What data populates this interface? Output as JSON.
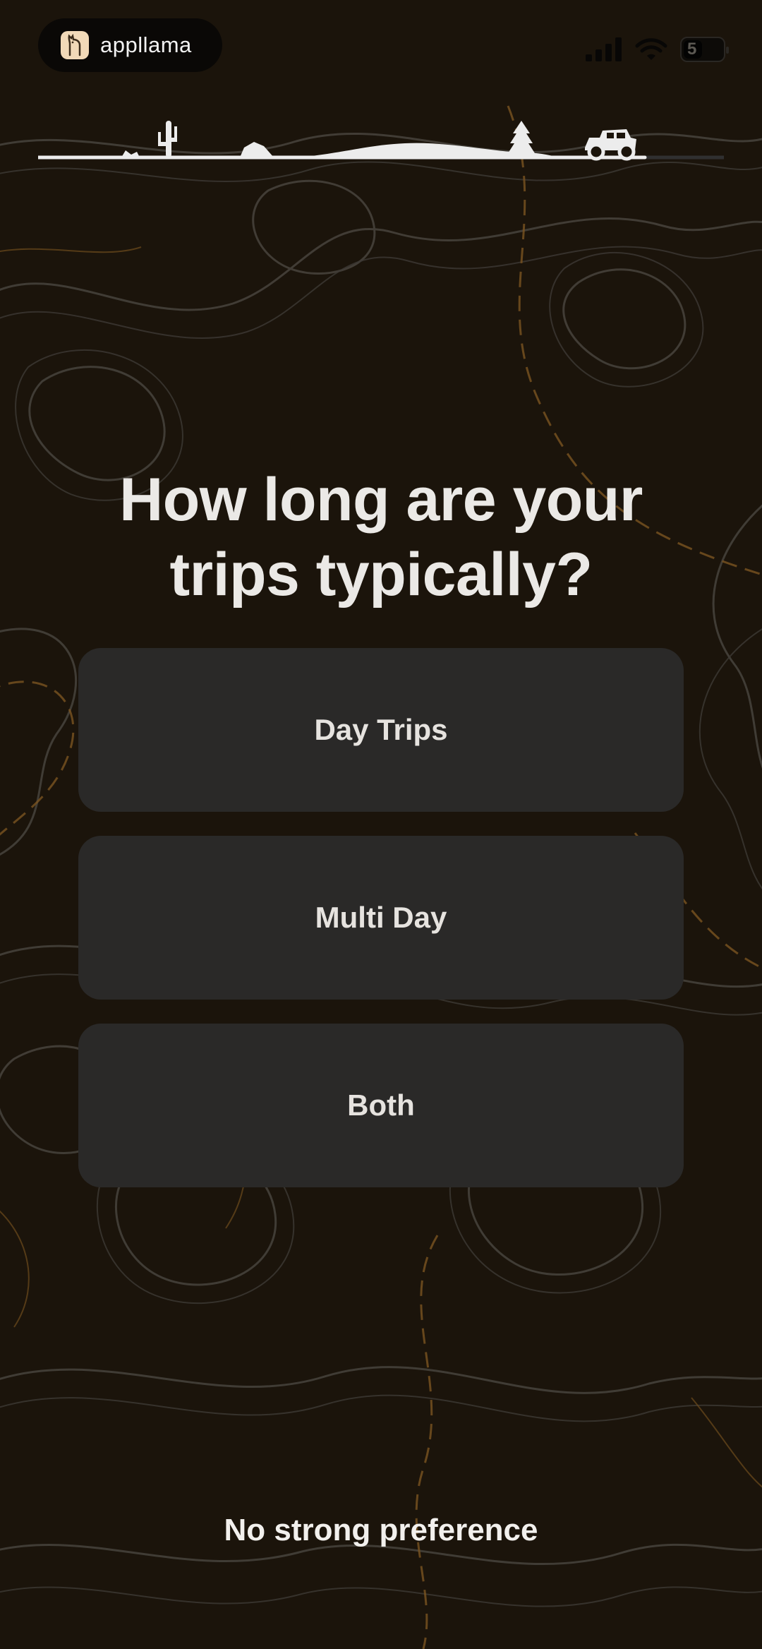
{
  "status_bar": {
    "app_name": "appllama",
    "logo_icon": "llama-icon",
    "signal_icon": "cellular-signal-icon",
    "wifi_icon": "wifi-icon",
    "battery_text": "5"
  },
  "progress": {
    "icons": [
      "cactus-icon",
      "rock-icon",
      "hill-icon",
      "pine-tree-icon",
      "offroad-jeep-icon"
    ],
    "jeep_position_fraction": 0.83
  },
  "question": {
    "line1": "How long are your",
    "line2": "trips typically?"
  },
  "options": [
    {
      "label": "Day Trips"
    },
    {
      "label": "Multi Day"
    },
    {
      "label": "Both"
    }
  ],
  "skip_label": "No strong preference",
  "colors": {
    "background": "#1b140b",
    "topo_line": "#5a5650",
    "topo_accent": "#8a5a1e",
    "option_bg": "#2a2928",
    "text": "#ebe9e6"
  }
}
